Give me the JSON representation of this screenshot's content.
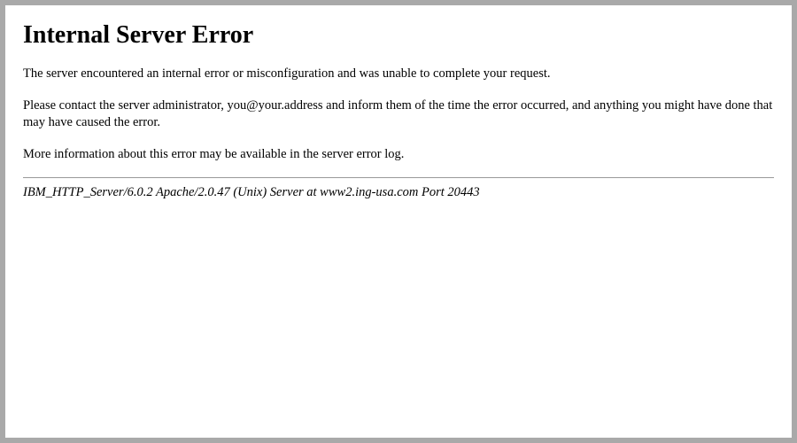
{
  "error": {
    "title": "Internal Server Error",
    "p1": "The server encountered an internal error or misconfiguration and was unable to complete your request.",
    "p2": "Please contact the server administrator, you@your.address and inform them of the time the error occurred, and anything you might have done that may have caused the error.",
    "p3": "More information about this error may be available in the server error log.",
    "signature": "IBM_HTTP_Server/6.0.2 Apache/2.0.47 (Unix) Server at www2.ing-usa.com Port 20443"
  }
}
